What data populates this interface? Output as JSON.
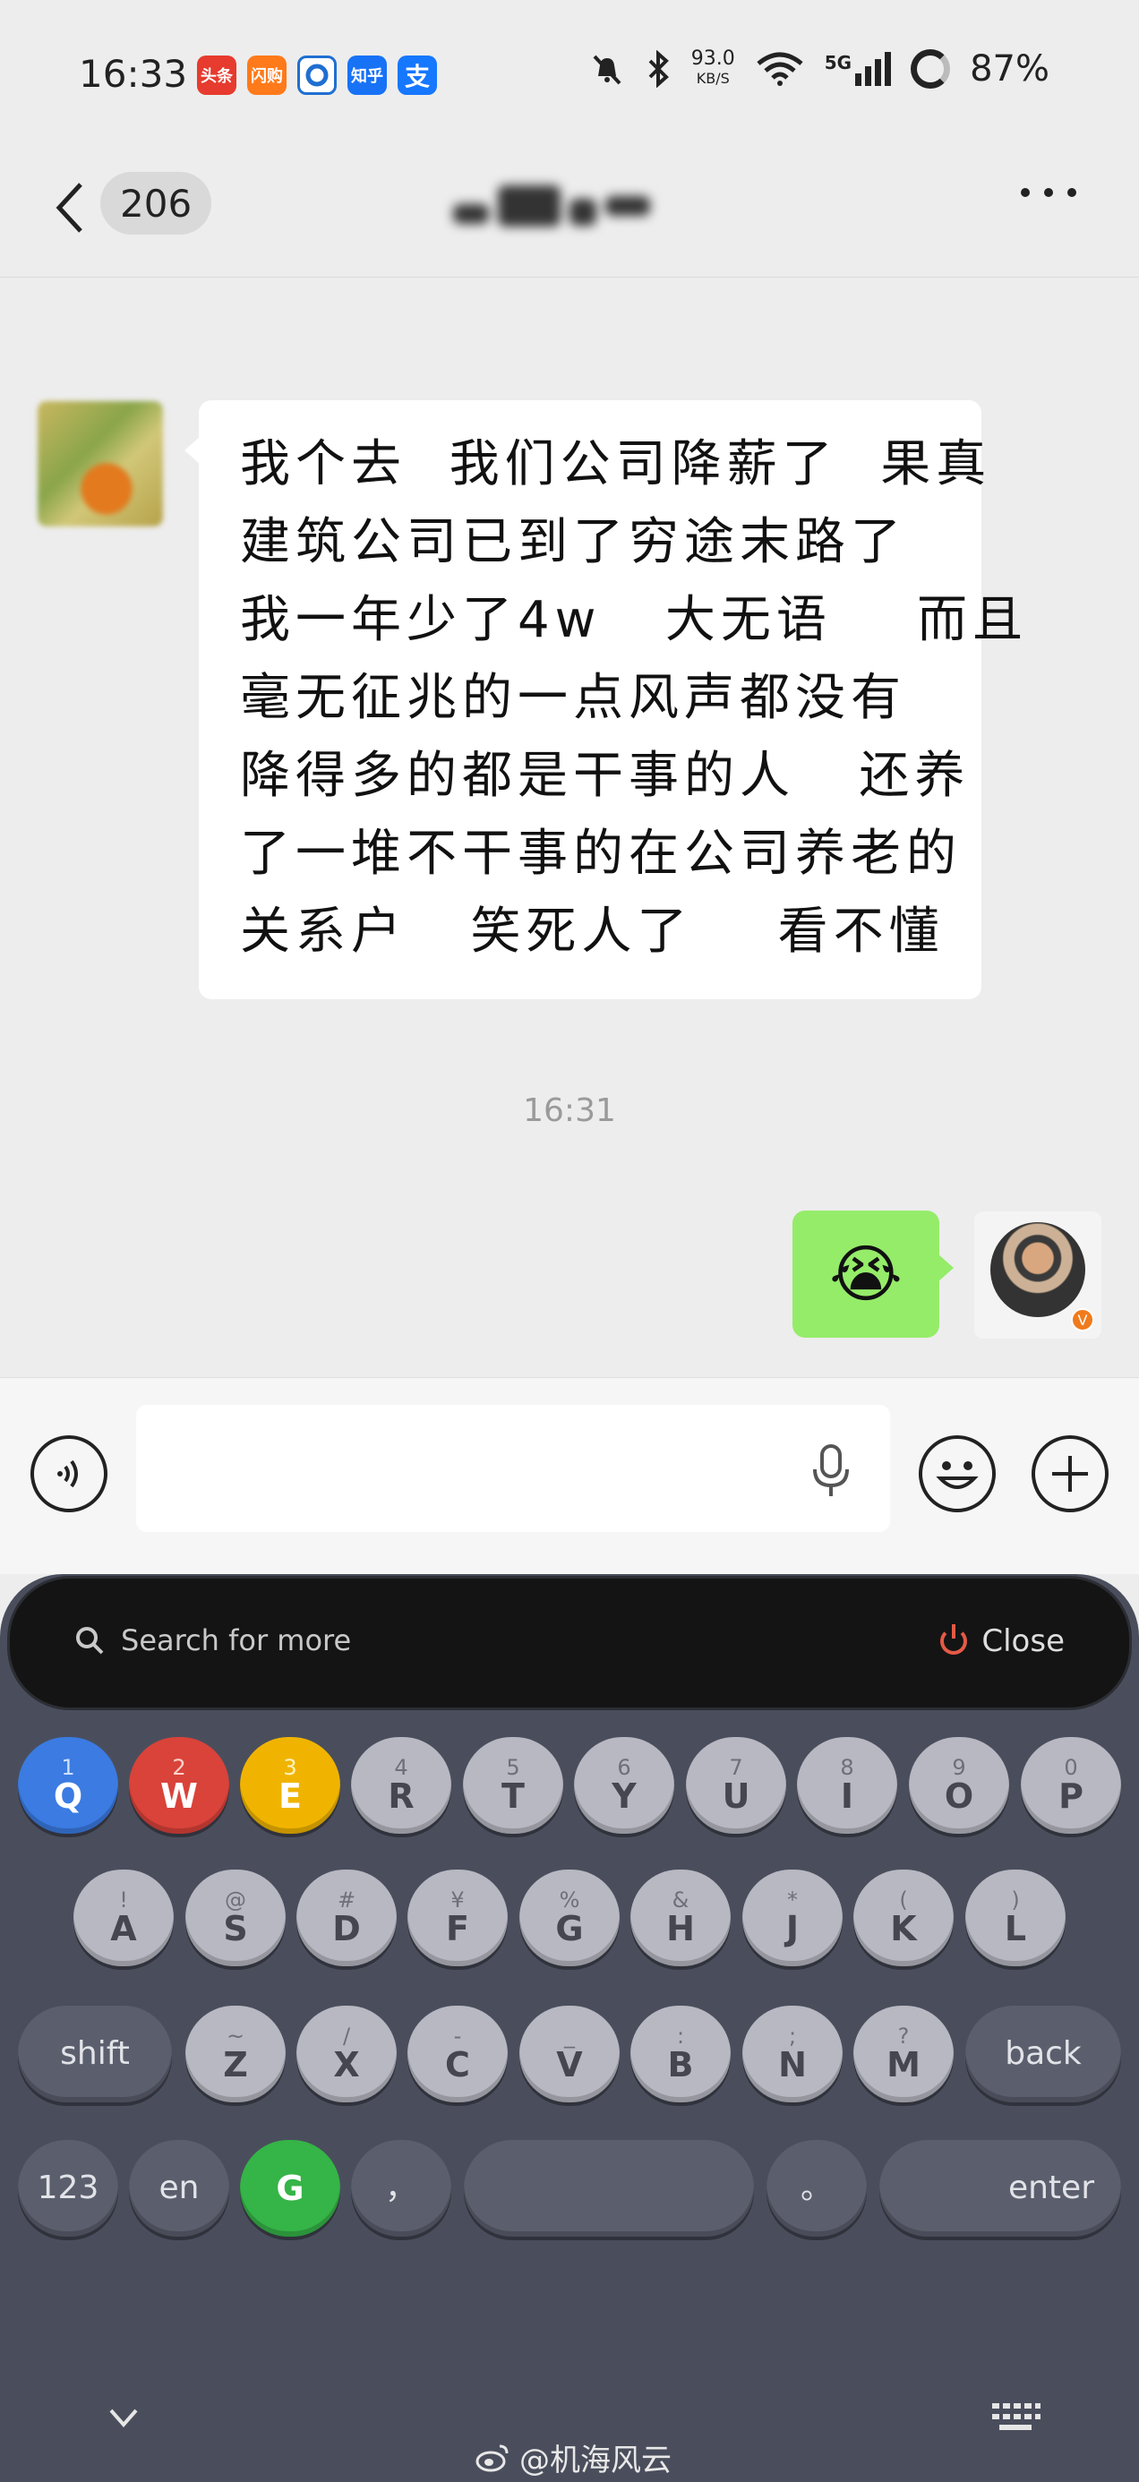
{
  "status_bar": {
    "time": "16:33",
    "apps": [
      {
        "icon": "toutiao-icon",
        "label": "头条",
        "color": "#e63b2e"
      },
      {
        "icon": "taobao-flash-icon",
        "label": "闪购",
        "color": "#ff7a1a"
      },
      {
        "icon": "bank-icon",
        "label": "",
        "color": "#1f6fd1"
      },
      {
        "icon": "zhihu-icon",
        "label": "知乎",
        "color": "#1772f6"
      },
      {
        "icon": "alipay-icon",
        "label": "支",
        "color": "#1677ff"
      }
    ],
    "net_speed_value": "93.0",
    "net_speed_unit": "KB/S",
    "network": "5G",
    "battery": "87%"
  },
  "header": {
    "unread_count": "206",
    "title_blurred": true
  },
  "messages": [
    {
      "direction": "incoming",
      "text_lines": [
        "我个去  我们公司降薪了  果真",
        "建筑公司已到了穷途末路了",
        "我一年少了4w   大无语    而且",
        "毫无征兆的一点风声都没有",
        "降得多的都是干事的人   还养",
        "了一堆不干事的在公司养老的",
        "关系户   笑死人了    看不懂"
      ]
    },
    {
      "direction": "timestamp",
      "text": "16:31"
    },
    {
      "direction": "outgoing",
      "emoji": "😭"
    }
  ],
  "input_bar": {
    "placeholder": ""
  },
  "keyboard": {
    "search_text": "Search for more",
    "close_label": "Close",
    "row1": [
      {
        "hint": "1",
        "key": "Q",
        "color": "blue"
      },
      {
        "hint": "2",
        "key": "W",
        "color": "red"
      },
      {
        "hint": "3",
        "key": "E",
        "color": "yellow"
      },
      {
        "hint": "4",
        "key": "R"
      },
      {
        "hint": "5",
        "key": "T"
      },
      {
        "hint": "6",
        "key": "Y"
      },
      {
        "hint": "7",
        "key": "U"
      },
      {
        "hint": "8",
        "key": "I"
      },
      {
        "hint": "9",
        "key": "O"
      },
      {
        "hint": "0",
        "key": "P"
      }
    ],
    "row2": [
      {
        "hint": "!",
        "key": "A"
      },
      {
        "hint": "@",
        "key": "S"
      },
      {
        "hint": "#",
        "key": "D"
      },
      {
        "hint": "¥",
        "key": "F"
      },
      {
        "hint": "%",
        "key": "G"
      },
      {
        "hint": "&",
        "key": "H"
      },
      {
        "hint": "*",
        "key": "J"
      },
      {
        "hint": "(",
        "key": "K"
      },
      {
        "hint": ")",
        "key": "L"
      }
    ],
    "row3": [
      {
        "hint": "~",
        "key": "Z"
      },
      {
        "hint": "/",
        "key": "X"
      },
      {
        "hint": "-",
        "key": "C"
      },
      {
        "hint": "_",
        "key": "V"
      },
      {
        "hint": ":",
        "key": "B"
      },
      {
        "hint": ";",
        "key": "N"
      },
      {
        "hint": "?",
        "key": "M"
      }
    ],
    "shift_label": "shift",
    "back_label": "back",
    "num_label": "123",
    "lang_label": "en",
    "g_label": "G",
    "comma_label": "，",
    "period_label": "。",
    "enter_label": "enter"
  },
  "watermark": "@机海风云"
}
